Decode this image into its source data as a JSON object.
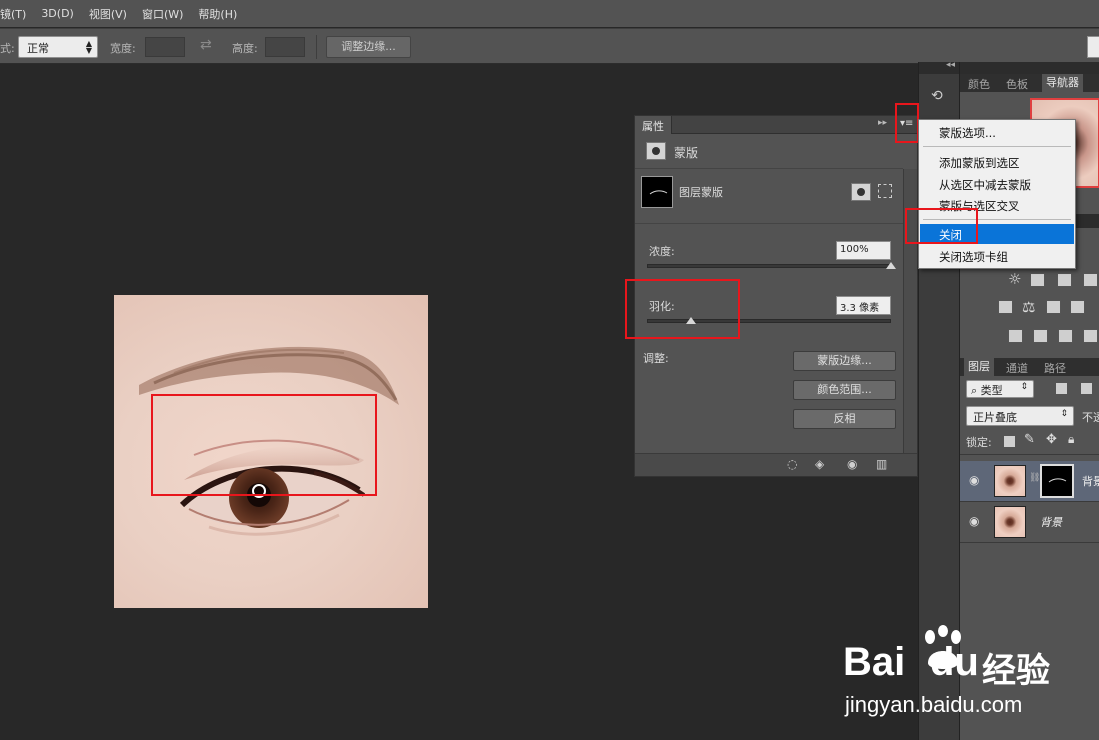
{
  "menubar": {
    "items": [
      "镜(T)",
      "3D(D)",
      "视图(V)",
      "窗口(W)",
      "帮助(H)"
    ]
  },
  "options": {
    "style_prefix": "式:",
    "style_value": "正常",
    "width_label": "宽度:",
    "height_label": "高度:",
    "refine_edge_button": "调整边缘..."
  },
  "properties_panel": {
    "tab_label": "属性",
    "section_title": "蒙版",
    "layer_mask_label": "图层蒙版",
    "density_label": "浓度:",
    "density_value": "100%",
    "density_fraction": 1.0,
    "feather_label": "羽化:",
    "feather_value": "3.3 像素",
    "feather_fraction": 0.18,
    "adjust_label": "调整:",
    "mask_edge_button": "蒙版边缘...",
    "color_range_button": "颜色范围...",
    "invert_button": "反相"
  },
  "flyout_menu": {
    "items": [
      {
        "label": "蒙版选项..."
      },
      {
        "label": "添加蒙版到选区"
      },
      {
        "label": "从选区中减去蒙版"
      },
      {
        "label": "蒙版与选区交叉"
      },
      {
        "label": "关闭",
        "selected": true
      },
      {
        "label": "关闭选项卡组"
      }
    ]
  },
  "right_dock": {
    "top_tabs": [
      "颜色",
      "色板",
      "导航器"
    ],
    "active_top_tab": "导航器",
    "layers_tabs": [
      "图层",
      "通道",
      "路径"
    ],
    "filter_kind": "类型",
    "blend_mode": "正片叠底",
    "opacity_label_partial": "不透",
    "lock_label": "锁定:",
    "layers": [
      {
        "name": "背景",
        "has_mask": true
      },
      {
        "name": "背景",
        "has_mask": false
      }
    ]
  },
  "watermark": {
    "brand_text": "Bai",
    "brand_text2": "du",
    "brand_cn": "经验",
    "url": "jingyan.baidu.com"
  },
  "colors": {
    "highlight": "#e8161c",
    "menu_selected": "#0a74d8",
    "ui_panel": "#535353",
    "canvas": "#282828"
  }
}
